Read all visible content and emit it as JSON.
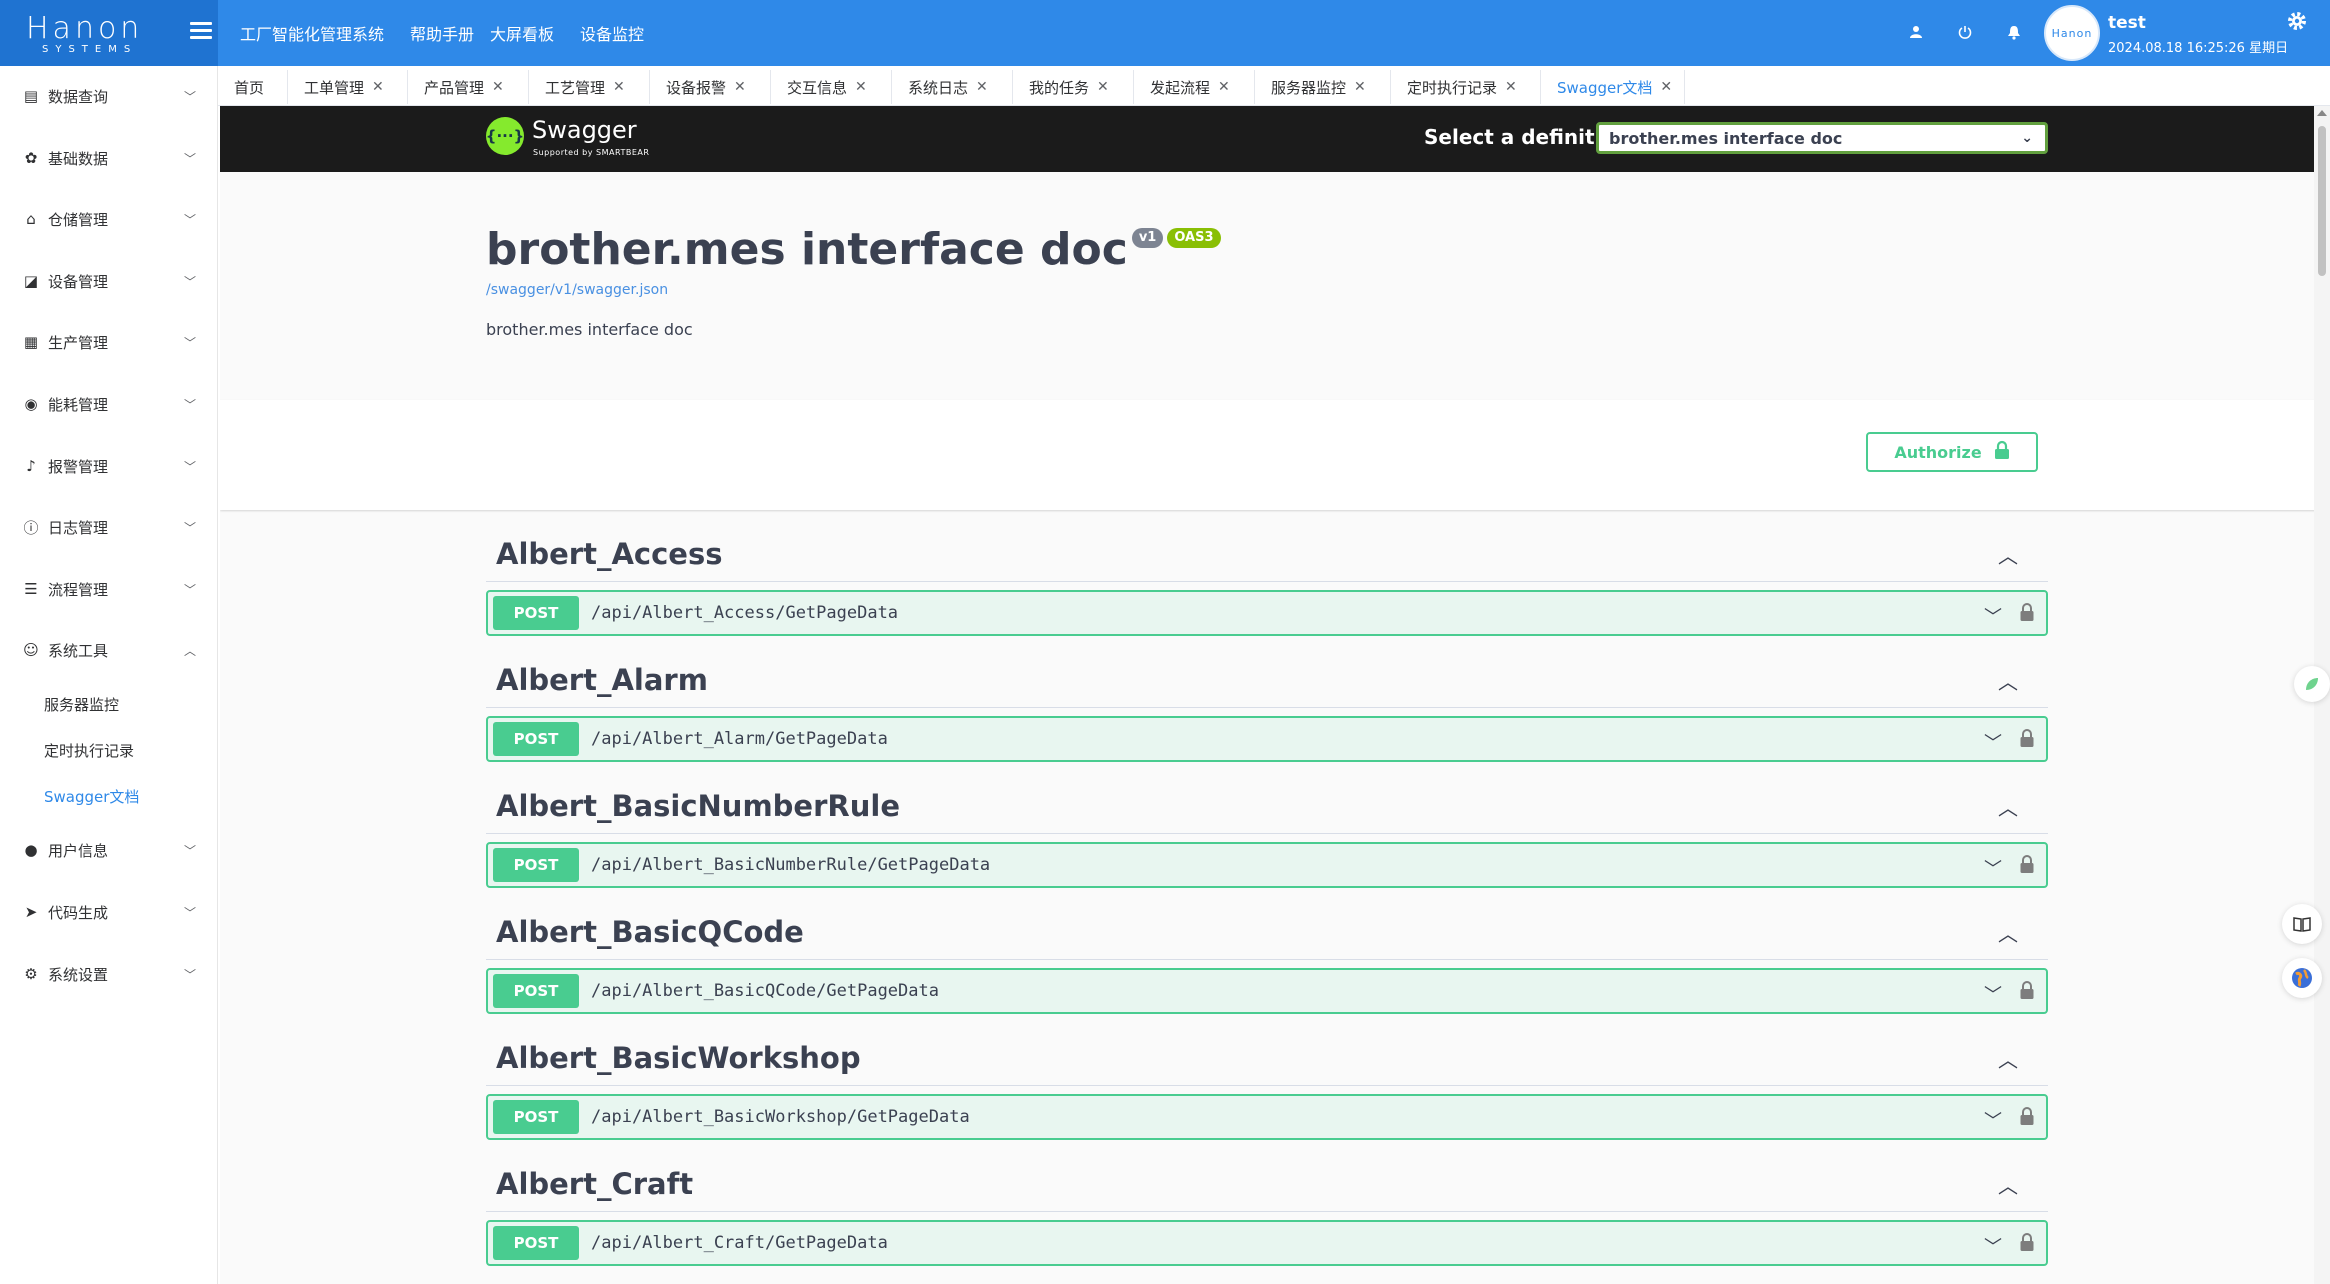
{
  "header": {
    "logo_text": "Hanon",
    "logo_sub": "SYSTEMS",
    "nav": [
      "工厂智能化管理系统",
      "帮助手册",
      "大屏看板",
      "设备监控"
    ],
    "username": "test",
    "datetime": "2024.08.18 16:25:26 星期日",
    "avatar_text": "Hanon"
  },
  "sidebar": {
    "items": [
      {
        "label": "数据查询",
        "icon": "document-icon"
      },
      {
        "label": "基础数据",
        "icon": "gear-icon"
      },
      {
        "label": "仓储管理",
        "icon": "home-icon"
      },
      {
        "label": "设备管理",
        "icon": "chart-icon"
      },
      {
        "label": "生产管理",
        "icon": "grid-icon"
      },
      {
        "label": "能耗管理",
        "icon": "aperture-icon"
      },
      {
        "label": "报警管理",
        "icon": "bell-icon"
      },
      {
        "label": "日志管理",
        "icon": "info-icon"
      },
      {
        "label": "流程管理",
        "icon": "sliders-icon"
      },
      {
        "label": "系统工具",
        "icon": "smile-icon"
      }
    ],
    "subitems": [
      "服务器监控",
      "定时执行记录",
      "Swagger文档"
    ],
    "items_after": [
      {
        "label": "用户信息",
        "icon": "user-icon"
      },
      {
        "label": "代码生成",
        "icon": "send-icon"
      },
      {
        "label": "系统设置",
        "icon": "settings-icon"
      }
    ]
  },
  "tabs": [
    "首页",
    "工单管理",
    "产品管理",
    "工艺管理",
    "设备报警",
    "交互信息",
    "系统日志",
    "我的任务",
    "发起流程",
    "服务器监控",
    "定时执行记录",
    "Swagger文档"
  ],
  "swagger": {
    "logo_text": "Swagger",
    "logo_sub": "Supported by SMARTBEAR",
    "select_label": "Select a definition",
    "select_value": "brother.mes interface doc",
    "title": "brother.mes interface doc",
    "version_badge": "v1",
    "oas_badge": "OAS3",
    "spec_link": "/swagger/v1/swagger.json",
    "description": "brother.mes interface doc",
    "authorize_label": "Authorize",
    "sections": [
      {
        "tag": "Albert_Access",
        "method": "POST",
        "path": "/api/Albert_Access/GetPageData"
      },
      {
        "tag": "Albert_Alarm",
        "method": "POST",
        "path": "/api/Albert_Alarm/GetPageData"
      },
      {
        "tag": "Albert_BasicNumberRule",
        "method": "POST",
        "path": "/api/Albert_BasicNumberRule/GetPageData"
      },
      {
        "tag": "Albert_BasicQCode",
        "method": "POST",
        "path": "/api/Albert_BasicQCode/GetPageData"
      },
      {
        "tag": "Albert_BasicWorkshop",
        "method": "POST",
        "path": "/api/Albert_BasicWorkshop/GetPageData"
      },
      {
        "tag": "Albert_Craft",
        "method": "POST",
        "path": "/api/Albert_Craft/GetPageData"
      }
    ]
  },
  "colors": {
    "header_blue": "#2f89e8",
    "post_green": "#49cc90",
    "swagger_dark": "#1b1b1b"
  }
}
